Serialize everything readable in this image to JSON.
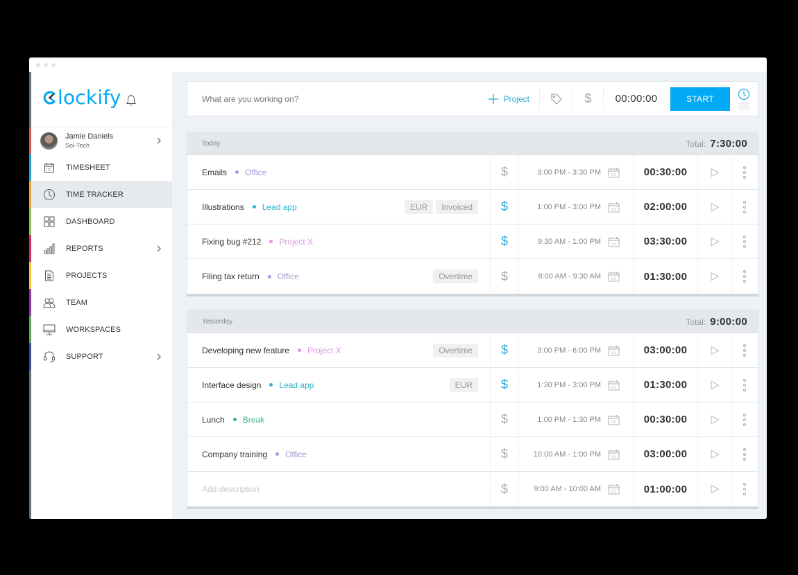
{
  "app": {
    "name": "Clockify",
    "window_dots": 3
  },
  "user": {
    "name": "Jamie Daniels",
    "workspace": "Sol-Tech"
  },
  "sidebar": {
    "items": [
      {
        "id": "timesheet",
        "label": "TIMESHEET",
        "icon": "calendar-icon",
        "color": "#1ea0d8",
        "chevron": false,
        "active": false
      },
      {
        "id": "time-tracker",
        "label": "TIME TRACKER",
        "icon": "clock-icon",
        "color": "#f3a33b",
        "chevron": false,
        "active": true
      },
      {
        "id": "dashboard",
        "label": "DASHBOARD",
        "icon": "dashboard-grid-icon",
        "color": "#8bc34a",
        "chevron": false,
        "active": false
      },
      {
        "id": "reports",
        "label": "REPORTS",
        "icon": "bar-chart-icon",
        "color": "#d3315f",
        "chevron": true,
        "active": false
      },
      {
        "id": "projects",
        "label": "PROJECTS",
        "icon": "document-icon",
        "color": "#f5c53b",
        "chevron": false,
        "active": false
      },
      {
        "id": "team",
        "label": "TEAM",
        "icon": "team-icon",
        "color": "#8e35a6",
        "chevron": false,
        "active": false
      },
      {
        "id": "workspaces",
        "label": "WORKSPACES",
        "icon": "monitor-icon",
        "color": "#5aa95c",
        "chevron": false,
        "active": false
      },
      {
        "id": "support",
        "label": "SUPPORT",
        "icon": "headset-icon",
        "color": "#3b4aa0",
        "chevron": true,
        "active": false
      }
    ],
    "user_strip_color": "#e0574a"
  },
  "tracker": {
    "placeholder": "What are you working on?",
    "project_label": "Project",
    "timer": "00:00:00",
    "start_label": "START"
  },
  "colors": {
    "accent": "#03a9f4",
    "office": "#9b9fd6",
    "lead_app": "#2bb5c9",
    "project_x": "#e58fe6",
    "break": "#3bb68c",
    "billable_active": "#2aa9d9",
    "billable_inactive": "#aaaaaa"
  },
  "days": [
    {
      "label": "Today",
      "total_label": "Total:",
      "total": "7:30:00",
      "entries": [
        {
          "description": "Emails",
          "project": "Office",
          "project_color": "#9b9fd6",
          "badges": [],
          "billable": false,
          "time_range": "3:00 PM - 3:30 PM",
          "duration": "00:30:00"
        },
        {
          "description": "Illustrations",
          "project": "Lead app",
          "project_color": "#2bb5c9",
          "badges": [
            "EUR",
            "Invoiced"
          ],
          "billable": true,
          "time_range": "1:00 PM - 3:00 PM",
          "duration": "02:00:00"
        },
        {
          "description": "Fixing bug #212",
          "project": "Project X",
          "project_color": "#e58fe6",
          "badges": [],
          "billable": true,
          "time_range": "9:30 AM - 1:00 PM",
          "duration": "03:30:00"
        },
        {
          "description": "Filing tax return",
          "project": "Office",
          "project_color": "#9b9fd6",
          "badges": [
            "Overtime"
          ],
          "billable": false,
          "time_range": "8:00 AM - 9:30 AM",
          "duration": "01:30:00"
        }
      ]
    },
    {
      "label": "Yesterday",
      "total_label": "Total:",
      "total": "9:00:00",
      "entries": [
        {
          "description": "Developing new feature",
          "project": "Project X",
          "project_color": "#e58fe6",
          "badges": [
            "Overtime"
          ],
          "billable": true,
          "time_range": "3:00 PM - 6:00 PM",
          "duration": "03:00:00"
        },
        {
          "description": "Interface design",
          "project": "Lead app",
          "project_color": "#2bb5c9",
          "badges": [
            "EUR"
          ],
          "billable": true,
          "time_range": "1:30 PM - 3:00 PM",
          "duration": "01:30:00"
        },
        {
          "description": "Lunch",
          "project": "Break",
          "project_color": "#3bb68c",
          "badges": [],
          "billable": false,
          "time_range": "1:00 PM - 1:30 PM",
          "duration": "00:30:00"
        },
        {
          "description": "Company training",
          "project": "Office",
          "project_color": "#9b9fd6",
          "badges": [],
          "billable": false,
          "time_range": "10:00 AM - 1:00 PM",
          "duration": "03:00:00"
        },
        {
          "description": "",
          "placeholder": "Add description",
          "project": "",
          "project_color": "",
          "badges": [],
          "billable": false,
          "time_range": "9:00 AM - 10:00 AM",
          "duration": "01:00:00"
        }
      ]
    }
  ]
}
